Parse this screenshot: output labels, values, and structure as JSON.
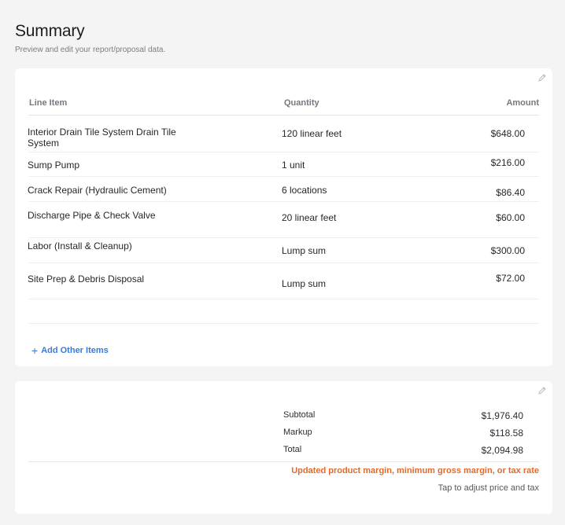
{
  "header": {
    "title": "Summary",
    "subtitle": "Preview and edit your report/proposal data."
  },
  "items_card": {
    "edit_icon": "pencil-icon",
    "columns": {
      "item": "Line Item",
      "quantity": "Quantity",
      "amount": "Amount"
    },
    "rows": [
      {
        "item": "Interior Drain Tile System Drain Tile System",
        "quantity": "120 linear feet",
        "amount": "$648.00"
      },
      {
        "item": "Sump Pump",
        "quantity": "1 unit",
        "amount": "$216.00"
      },
      {
        "item": "Crack Repair (Hydraulic Cement)",
        "quantity": "6 locations",
        "amount": "$86.40"
      },
      {
        "item": "Discharge Pipe & Check Valve",
        "quantity": "20 linear feet",
        "amount": "$60.00"
      },
      {
        "item": "Labor (Install & Cleanup)",
        "quantity": "Lump sum",
        "amount": "$300.00"
      },
      {
        "item": "Site Prep & Debris Disposal",
        "quantity": "Lump sum",
        "amount": "$72.00"
      }
    ],
    "add_label": "Add Other Items"
  },
  "totals_card": {
    "edit_icon": "pencil-icon",
    "subtotal_label": "Subtotal",
    "subtotal_value": "$1,976.40",
    "markup_label": "Markup",
    "markup_value": "$118.58",
    "total_label": "Total",
    "total_value": "$2,094.98",
    "warning": "Updated product margin, minimum gross margin, or tax rate",
    "hint": "Tap to adjust price and tax"
  },
  "colors": {
    "accent": "#3b7ad9",
    "warning": "#e06a2c",
    "background": "#f4f4f5",
    "card": "#ffffff"
  }
}
